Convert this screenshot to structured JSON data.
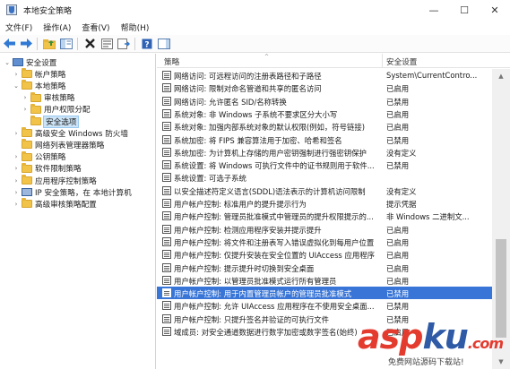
{
  "window": {
    "title": "本地安全策略",
    "min_glyph": "—",
    "max_glyph": "☐",
    "close_glyph": "✕"
  },
  "menu": [
    "文件(F)",
    "操作(A)",
    "查看(V)",
    "帮助(H)"
  ],
  "toolbar_icons": [
    "back-arrow-icon",
    "forward-arrow-icon",
    "up-folder-icon",
    "show-tree-icon",
    "delete-icon",
    "properties-icon",
    "export-list-icon",
    "help-icon",
    "show-pane-icon"
  ],
  "tree": [
    {
      "label": "安全设置",
      "indent": 0,
      "expanded": true,
      "icon": "pc"
    },
    {
      "label": "帐户策略",
      "indent": 1,
      "expanded": false,
      "icon": "folder"
    },
    {
      "label": "本地策略",
      "indent": 1,
      "expanded": true,
      "icon": "folder"
    },
    {
      "label": "审核策略",
      "indent": 2,
      "expanded": false,
      "icon": "folder"
    },
    {
      "label": "用户权限分配",
      "indent": 2,
      "expanded": false,
      "icon": "folder"
    },
    {
      "label": "安全选项",
      "indent": 2,
      "expanded": null,
      "icon": "folder",
      "selected": true
    },
    {
      "label": "高级安全 Windows 防火墙",
      "indent": 1,
      "expanded": false,
      "icon": "folder"
    },
    {
      "label": "网络列表管理器策略",
      "indent": 1,
      "expanded": null,
      "icon": "folder"
    },
    {
      "label": "公钥策略",
      "indent": 1,
      "expanded": false,
      "icon": "folder"
    },
    {
      "label": "软件限制策略",
      "indent": 1,
      "expanded": false,
      "icon": "folder"
    },
    {
      "label": "应用程序控制策略",
      "indent": 1,
      "expanded": false,
      "icon": "folder"
    },
    {
      "label": "IP 安全策略，在 本地计算机",
      "indent": 1,
      "expanded": false,
      "icon": "shield"
    },
    {
      "label": "高级审核策略配置",
      "indent": 1,
      "expanded": false,
      "icon": "folder"
    }
  ],
  "list": {
    "col_policy": "策略",
    "col_setting": "安全设置",
    "rows": [
      {
        "policy": "网络访问: 可远程访问的注册表路径和子路径",
        "setting": "System\\CurrentContro..."
      },
      {
        "policy": "网络访问: 限制对命名管道和共享的匿名访问",
        "setting": "已启用"
      },
      {
        "policy": "网络访问: 允许匿名 SID/名称转换",
        "setting": "已禁用"
      },
      {
        "policy": "系统对象: 非 Windows 子系统不要求区分大小写",
        "setting": "已启用"
      },
      {
        "policy": "系统对象: 加强内部系统对象的默认权限(例如，符号链接)",
        "setting": "已启用"
      },
      {
        "policy": "系统加密: 将 FIPS 兼容算法用于加密、哈希和签名",
        "setting": "已禁用"
      },
      {
        "policy": "系统加密: 为计算机上存储的用户密钥强制进行强密钥保护",
        "setting": "没有定义"
      },
      {
        "policy": "系统设置: 将 Windows 可执行文件中的证书规则用于软件...",
        "setting": "已禁用"
      },
      {
        "policy": "系统设置: 可选子系统",
        "setting": ""
      },
      {
        "policy": "以安全描述符定义语言(SDDL)语法表示的计算机访问限制",
        "setting": "没有定义"
      },
      {
        "policy": "用户帐户控制: 标准用户的提升提示行为",
        "setting": "提示凭据"
      },
      {
        "policy": "用户帐户控制: 管理员批准模式中管理员的提升权限提示的...",
        "setting": "非 Windows 二进制文..."
      },
      {
        "policy": "用户帐户控制: 检测应用程序安装并提示提升",
        "setting": "已启用"
      },
      {
        "policy": "用户帐户控制: 将文件和注册表写入错误虚拟化到每用户位置",
        "setting": "已启用"
      },
      {
        "policy": "用户帐户控制: 仅提升安装在安全位置的 UIAccess 应用程序",
        "setting": "已启用"
      },
      {
        "policy": "用户帐户控制: 提示提升时切换到安全桌面",
        "setting": "已启用"
      },
      {
        "policy": "用户帐户控制: 以管理员批准模式运行所有管理员",
        "setting": "已启用"
      },
      {
        "policy": "用户帐户控制: 用于内置管理员帐户的管理员批准模式",
        "setting": "已禁用",
        "selected": true
      },
      {
        "policy": "用户帐户控制: 允许 UIAccess 应用程序在不使用安全桌面...",
        "setting": "已禁用"
      },
      {
        "policy": "用户帐户控制: 只提升签名并验证的可执行文件",
        "setting": "已禁用"
      },
      {
        "policy": "域成员: 对安全通道数据进行数字加密或数字签名(始终)",
        "setting": "已启用"
      }
    ]
  },
  "watermark": {
    "logo_a": "asp",
    "logo_b": "ku",
    "logo_c": ".com",
    "sub": "免费网站源码下载站!"
  },
  "colors": {
    "selection": "#3875d7",
    "tree_selection": "#cce4f7",
    "watermark_red": "#e43b2f",
    "watermark_blue": "#2f5aa6"
  }
}
